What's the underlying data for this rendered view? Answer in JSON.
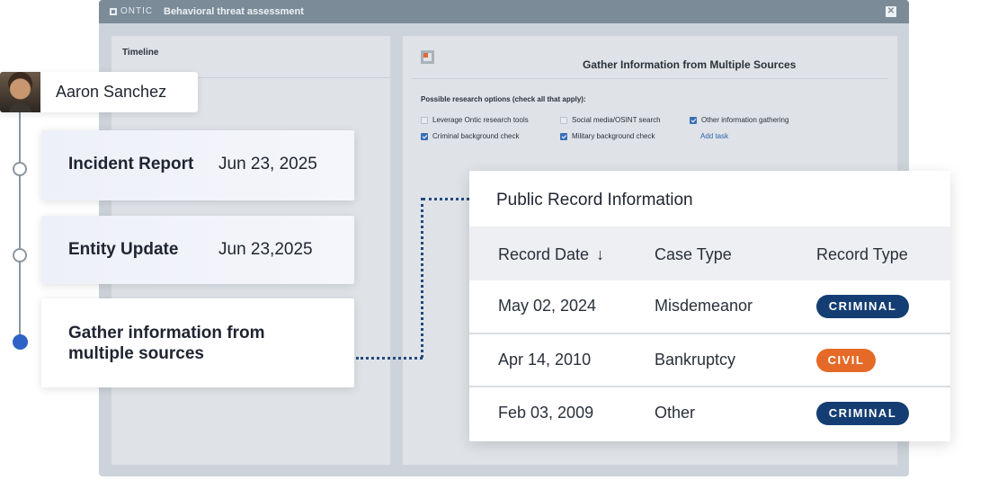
{
  "app": {
    "logo_text": "ONTIC",
    "window_title": "Behavioral threat assessment",
    "close_glyph": "✕"
  },
  "timeline_panel": {
    "title": "Timeline"
  },
  "research_panel": {
    "title": "Gather Information from Multiple Sources",
    "question": "Possible research options (check all that apply):",
    "options": [
      {
        "label": "Leverage Ontic research tools",
        "checked": false
      },
      {
        "label": "Social media/OSINT search",
        "checked": false
      },
      {
        "label": "Other information gathering",
        "checked": true
      },
      {
        "label": "Criminal background check",
        "checked": true
      },
      {
        "label": "Military background check",
        "checked": true
      }
    ],
    "add_task_label": "Add task"
  },
  "person": {
    "name": "Aaron Sanchez"
  },
  "events": [
    {
      "title": "Incident Report",
      "date": "Jun 23, 2025"
    },
    {
      "title": "Entity Update",
      "date": "Jun 23,2025"
    },
    {
      "title": "Gather information from multiple sources"
    }
  ],
  "public_records": {
    "title": "Public Record Information",
    "columns": [
      "Record Date",
      "Case Type",
      "Record Type"
    ],
    "sort_icon": "arrow-down-icon",
    "rows": [
      {
        "date": "May 02, 2024",
        "case_type": "Misdemeanor",
        "record_type": "CRIMINAL"
      },
      {
        "date": "Apr 14, 2010",
        "case_type": "Bankruptcy",
        "record_type": "CIVIL"
      },
      {
        "date": "Feb 03, 2009",
        "case_type": "Other",
        "record_type": "CRIMINAL"
      }
    ]
  },
  "colors": {
    "criminal_badge": "#143e73",
    "civil_badge": "#e56a28",
    "timeline_active": "#2f62c6",
    "connector": "#244a7f"
  }
}
